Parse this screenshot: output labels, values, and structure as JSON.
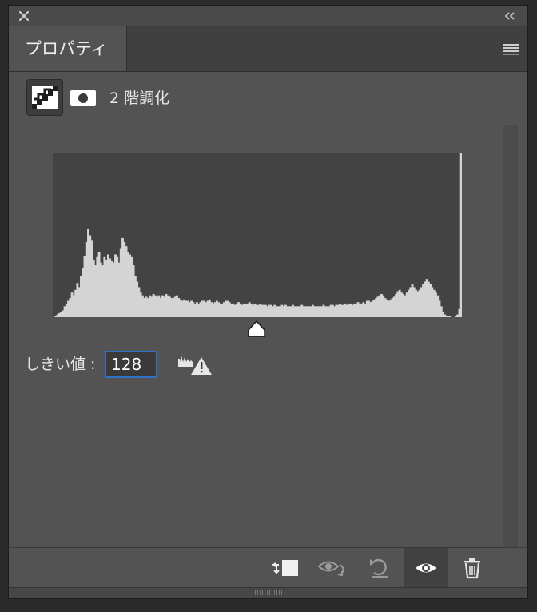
{
  "window": {
    "close_icon": "close-icon",
    "collapse_icon": "double-chevron-left-icon"
  },
  "tab": {
    "label": "プロパティ",
    "menu_icon": "hamburger-menu-icon"
  },
  "adjustment": {
    "title": "2 階調化",
    "adjustment_icon": "threshold-adjustment-icon",
    "mask_icon": "layer-mask-icon"
  },
  "histogram": {
    "bar_color": "#d4d4d4",
    "background": "#434343",
    "slider_icon": "threshold-slider-icon",
    "values": [
      0,
      1,
      2,
      3,
      4,
      5,
      8,
      10,
      12,
      14,
      18,
      16,
      20,
      25,
      22,
      30,
      36,
      45,
      55,
      65,
      60,
      56,
      42,
      38,
      44,
      48,
      40,
      38,
      44,
      42,
      46,
      43,
      41,
      40,
      46,
      44,
      40,
      50,
      58,
      55,
      52,
      48,
      46,
      44,
      38,
      30,
      26,
      22,
      18,
      16,
      14,
      15,
      14,
      16,
      15,
      17,
      16,
      15,
      16,
      14,
      16,
      15,
      17,
      16,
      15,
      14,
      14,
      15,
      16,
      14,
      13,
      12,
      13,
      12,
      12,
      11,
      12,
      11,
      10,
      11,
      10,
      11,
      12,
      12,
      11,
      12,
      13,
      11,
      10,
      11,
      12,
      11,
      10,
      10,
      11,
      12,
      12,
      11,
      10,
      10,
      9,
      10,
      11,
      10,
      9,
      10,
      10,
      10,
      11,
      10,
      9,
      10,
      9,
      9,
      10,
      9,
      9,
      9,
      8,
      9,
      9,
      8,
      9,
      8,
      8,
      8,
      9,
      8,
      9,
      8,
      8,
      8,
      9,
      8,
      8,
      8,
      8,
      9,
      8,
      8,
      8,
      8,
      8,
      9,
      8,
      8,
      8,
      8,
      8,
      9,
      8,
      8,
      8,
      9,
      9,
      8,
      9,
      9,
      10,
      9,
      9,
      10,
      9,
      10,
      10,
      9,
      10,
      10,
      11,
      10,
      10,
      11,
      10,
      12,
      12,
      11,
      12,
      13,
      14,
      15,
      16,
      17,
      16,
      14,
      13,
      12,
      13,
      14,
      15,
      17,
      19,
      20,
      18,
      17,
      16,
      18,
      20,
      22,
      24,
      22,
      20,
      19,
      20,
      22,
      24,
      26,
      28,
      26,
      24,
      22,
      20,
      18,
      16,
      12,
      8,
      4,
      2,
      1,
      1,
      1,
      0,
      0,
      1,
      2,
      6,
      120
    ]
  },
  "threshold": {
    "label": "しきい値 :",
    "value": "128",
    "warning_icon": "histogram-warning-icon"
  },
  "bottom_toolbar": {
    "clip_icon": "clip-to-layer-icon",
    "view_previous_icon": "view-previous-state-icon",
    "reset_icon": "reset-icon",
    "visibility_icon": "eye-icon",
    "delete_icon": "trash-icon"
  }
}
